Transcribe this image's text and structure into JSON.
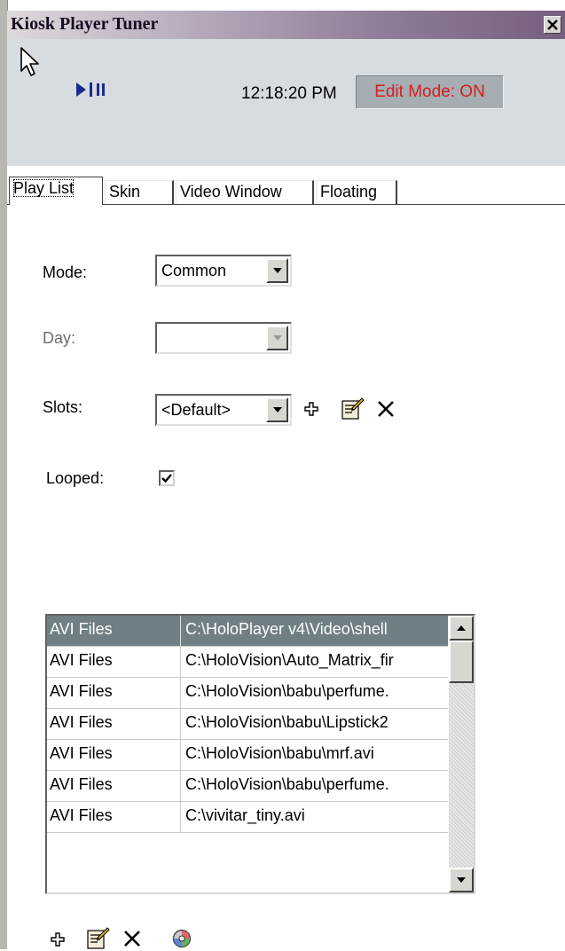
{
  "window": {
    "title": "Kiosk Player Tuner"
  },
  "header": {
    "clock": "12:18:20 PM",
    "edit_mode": "Edit Mode: ON"
  },
  "tabs": [
    {
      "label": "Play List",
      "active": true
    },
    {
      "label": "Skin"
    },
    {
      "label": "Video Window"
    },
    {
      "label": "Floating"
    }
  ],
  "form": {
    "mode_label": "Mode:",
    "mode_value": "Common",
    "day_label": "Day:",
    "day_value": "",
    "slots_label": "Slots:",
    "slots_value": "<Default>",
    "looped_label": "Looped:",
    "looped_checked": true
  },
  "playlist": {
    "rows": [
      {
        "type": "AVI Files",
        "path": "C:\\HoloPlayer v4\\Video\\shell",
        "selected": true
      },
      {
        "type": "AVI Files",
        "path": "C:\\HoloVision\\Auto_Matrix_fir"
      },
      {
        "type": "AVI Files",
        "path": "C:\\HoloVision\\babu\\perfume."
      },
      {
        "type": "AVI Files",
        "path": "C:\\HoloVision\\babu\\Lipstick2"
      },
      {
        "type": "AVI Files",
        "path": "C:\\HoloVision\\babu\\mrf.avi"
      },
      {
        "type": "AVI Files",
        "path": "C:\\HoloVision\\babu\\perfume."
      },
      {
        "type": "AVI Files",
        "path": "C:\\vivitar_tiny.avi"
      }
    ]
  },
  "colors": {
    "selection": "#6f7f84",
    "edit_mode_text": "#d12020",
    "header_bg": "#d6dcdf"
  },
  "icons": [
    "mouse-pointer-icon",
    "play-pause-icon",
    "close-icon",
    "add-icon",
    "edit-icon",
    "delete-icon",
    "cd-disc-icon",
    "chevron-down-icon",
    "chevron-up-icon",
    "checkmark-icon"
  ]
}
